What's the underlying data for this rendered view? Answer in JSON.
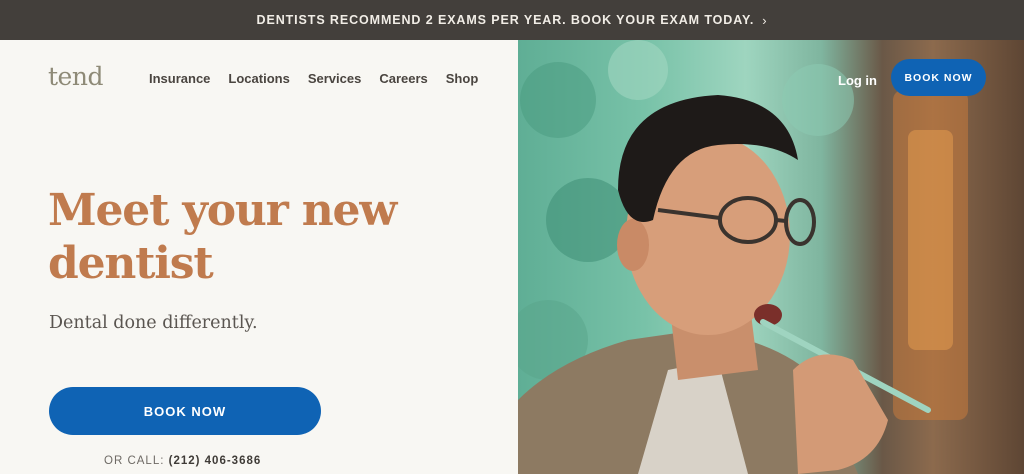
{
  "announcement": {
    "text": "DENTISTS RECOMMEND 2 EXAMS PER YEAR. BOOK YOUR EXAM TODAY.",
    "chevron": "›"
  },
  "header": {
    "logo": "tend",
    "nav": [
      "Insurance",
      "Locations",
      "Services",
      "Careers",
      "Shop"
    ],
    "login": "Log in",
    "book_now": "BOOK NOW"
  },
  "hero": {
    "title_line1": "Meet your new",
    "title_line2": "dentist",
    "subtitle": "Dental done differently.",
    "cta": "BOOK NOW",
    "call_label": "OR CALL:",
    "phone": "(212) 406-3686"
  },
  "colors": {
    "announcement_bg": "#433f3b",
    "accent_blue": "#0f63b4",
    "title_copper": "#c07b4e",
    "page_bg": "#f8f7f3"
  }
}
